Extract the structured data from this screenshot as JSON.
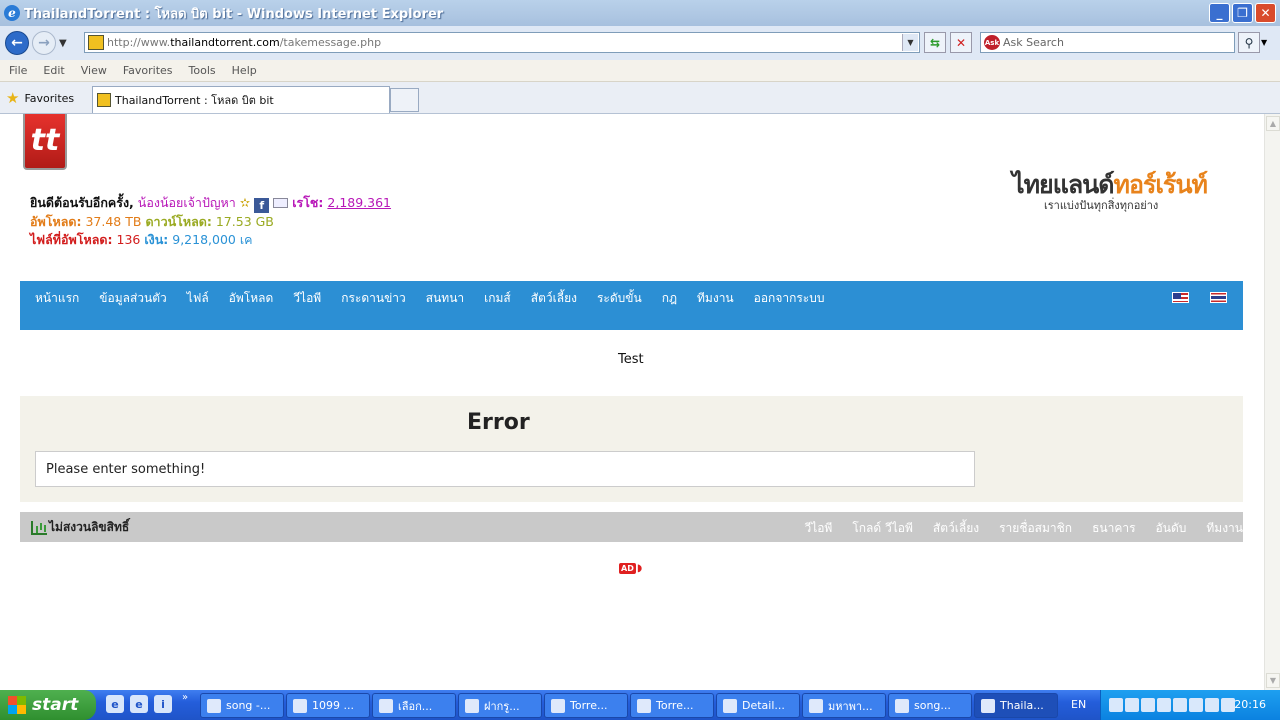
{
  "window": {
    "title": "ThailandTorrent : โหลด บิต bit - Windows Internet Explorer",
    "ie_icon": "ie-logo-icon"
  },
  "addressbar": {
    "url_scheme_www": "http://www.",
    "url_host": "thailandtorrent.com",
    "url_path": "/takemessage.php",
    "search_placeholder": "Ask Search"
  },
  "menu": [
    "File",
    "Edit",
    "View",
    "Favorites",
    "Tools",
    "Help"
  ],
  "favorites_label": "Favorites",
  "tab": {
    "label": "ThailandTorrent : โหลด บิต bit"
  },
  "user": {
    "welcome": "ยินดีต้อนรับอีกครั้ง,",
    "username": "น้องน้อยเจ้าปัญหา",
    "rep_label": "เรโช:",
    "rep_value": "2,189.361",
    "upload_label": "อัพโหลด:",
    "upload_value": "37.48 TB",
    "download_label": "ดาวน์โหลด:",
    "download_value": "17.53 GB",
    "files_label": "ไฟล์ที่อัพโหลด:",
    "files_value": "136",
    "money_label": "เงิน:",
    "money_value": "9,218,000 เค"
  },
  "brand": {
    "title_a": "ไทยแลนด์",
    "title_b": "ทอร์เร้นท์",
    "subtitle": "เราแบ่งปันทุกสิ่งทุกอย่าง"
  },
  "nav": [
    "หน้าแรก",
    "ข้อมูลส่วนตัว",
    "ไฟล์",
    "อัพโหลด",
    "วีไอพี",
    "กระดานข่าว",
    "สนทนา",
    "เกมส์",
    "สัตว์เลี้ยง",
    "ระดับขั้น",
    "กฎ",
    "ทีมงาน",
    "ออกจากระบบ"
  ],
  "main": {
    "test_text": "Test",
    "error_title": "Error",
    "error_message": "Please enter something!"
  },
  "footer": {
    "left_label": "ไม่สงวนลิขสิทธิ์",
    "links": [
      "วีไอพี",
      "โกลด์ วีไอพี",
      "สัตว์เลี้ยง",
      "รายชื่อสมาชิก",
      "ธนาคาร",
      "อันดับ",
      "ทีมงาน"
    ]
  },
  "taskbar": {
    "start_label": "start",
    "tasks": [
      "song -...",
      "1099 ...",
      "เลือก...",
      "ฝากรู...",
      "Torre...",
      "Torre...",
      "Detail...",
      "มหาพา...",
      "song...",
      "Thaila..."
    ],
    "language": "EN",
    "clock": "20:16"
  }
}
